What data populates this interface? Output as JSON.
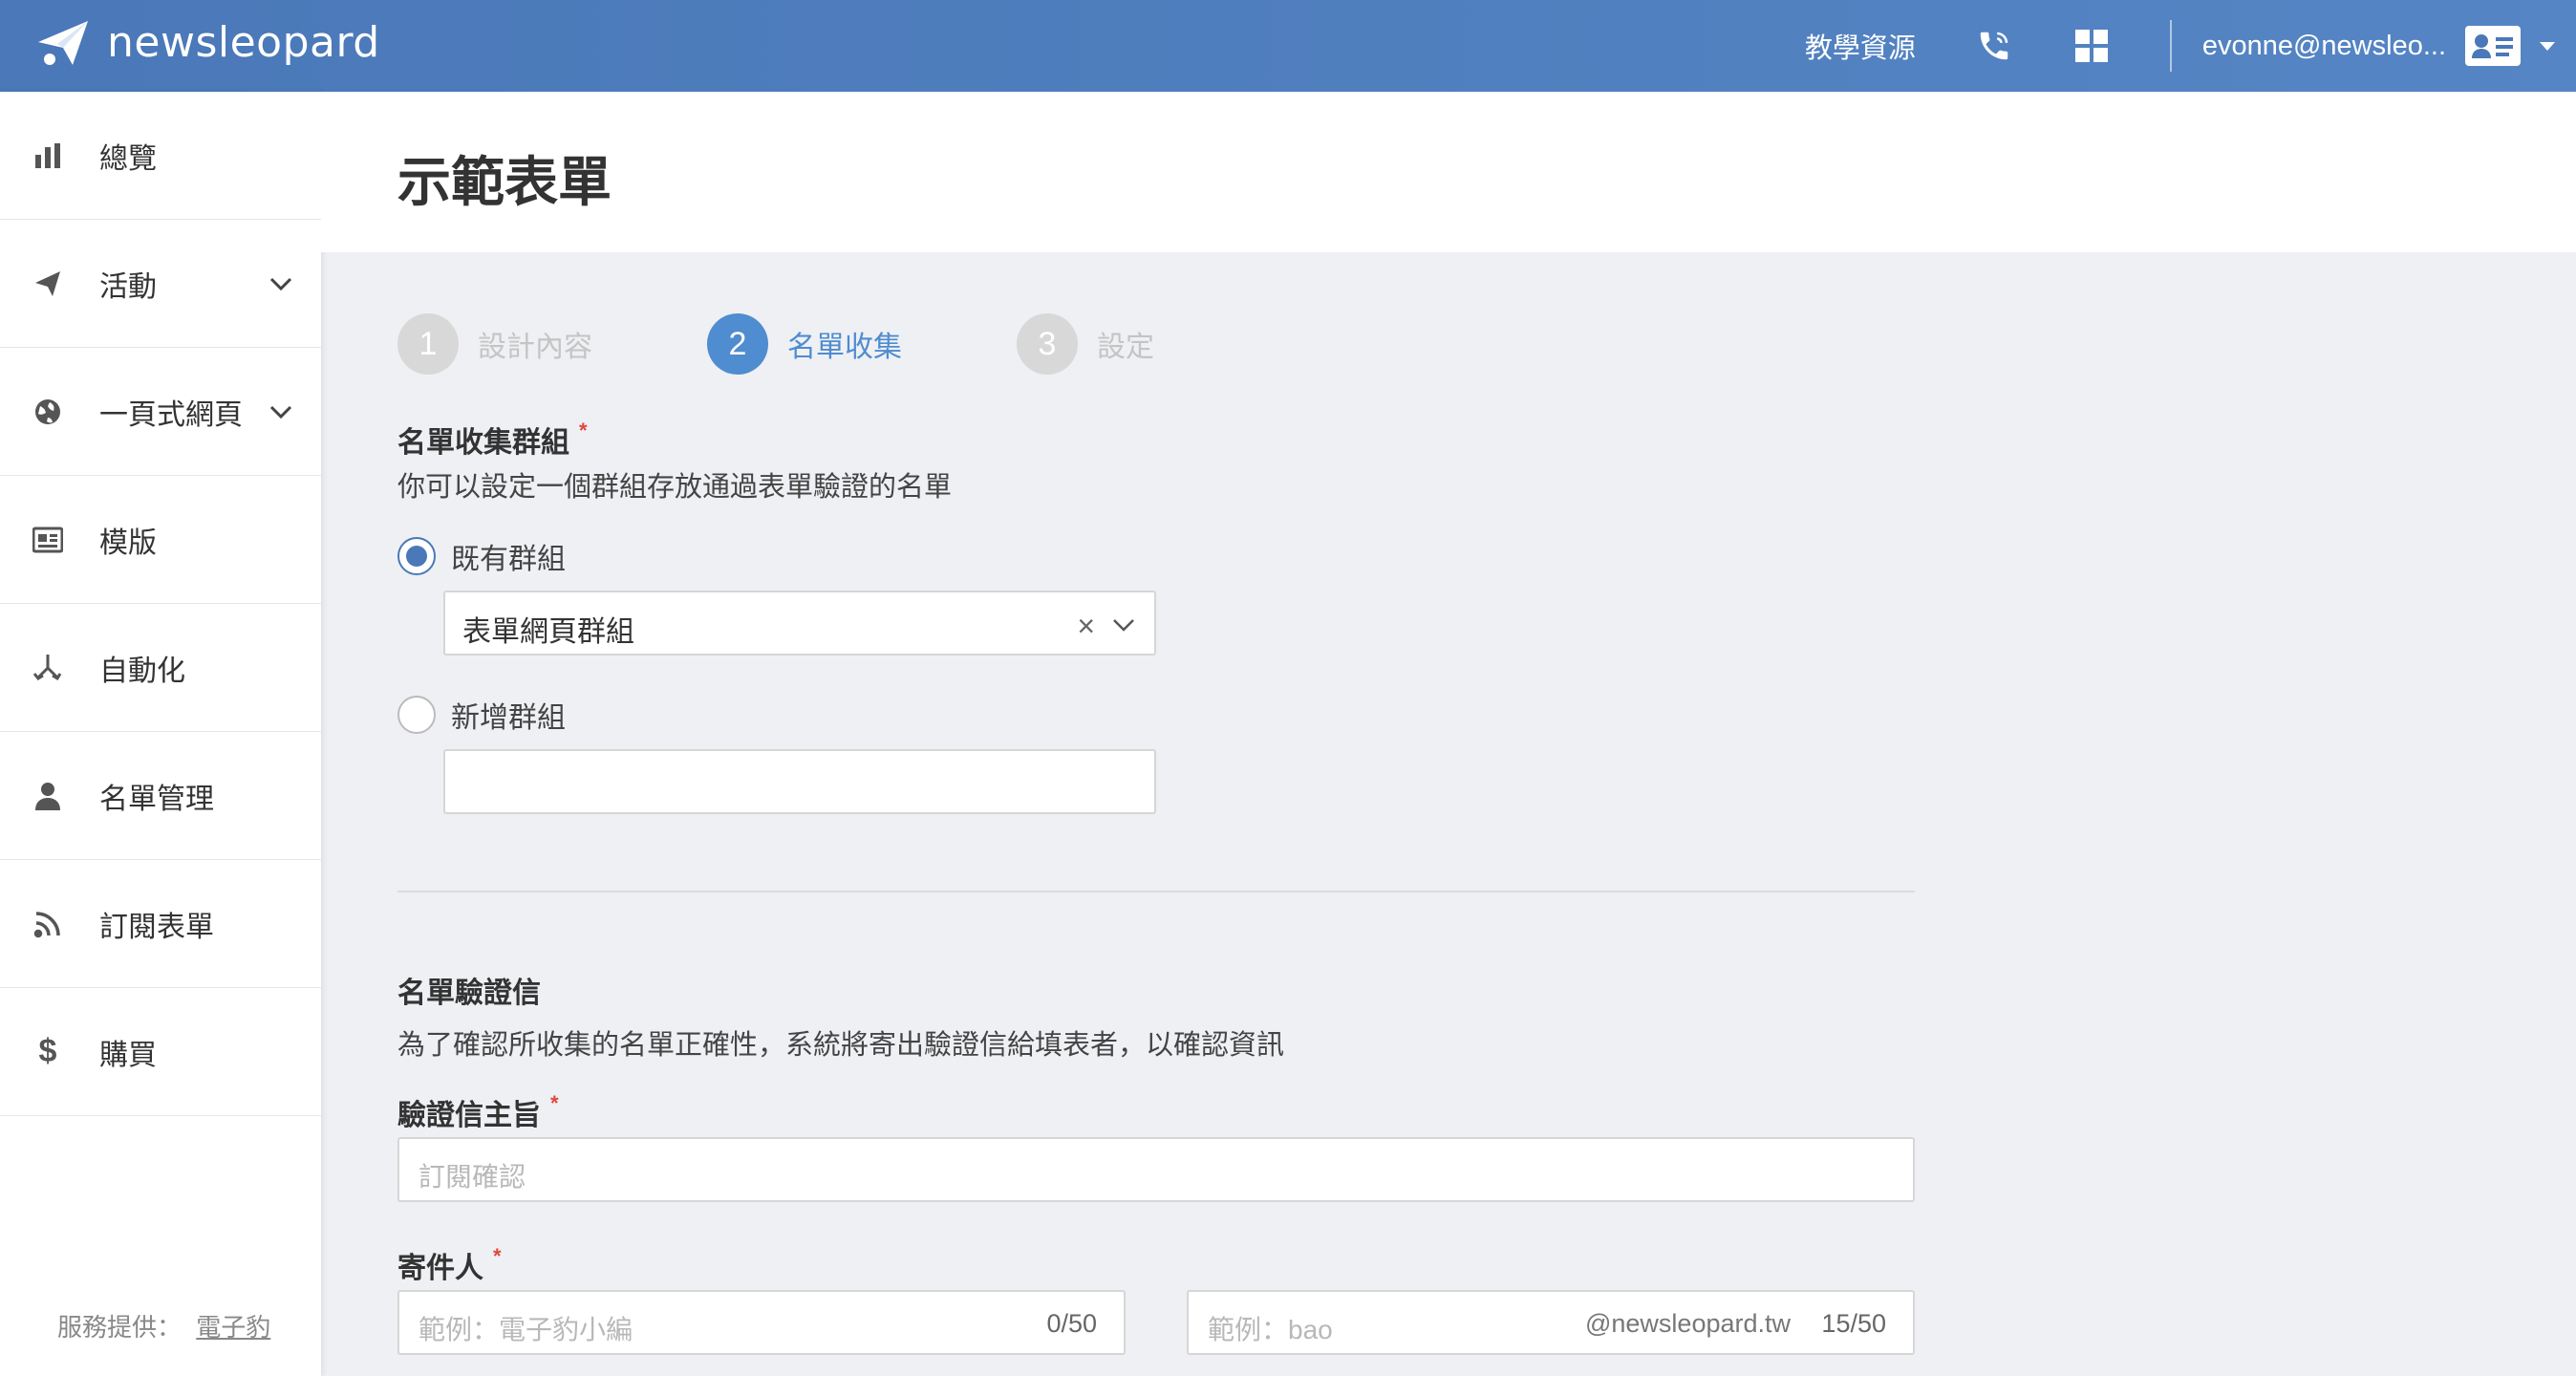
{
  "app": {
    "brand": "newsleopard"
  },
  "topbar": {
    "tutorial_label": "教學資源",
    "phone_icon": "phone-icon",
    "apps_icon": "grid-icon",
    "user_email": "evonne@newsleo...",
    "profile_icon": "id-card-icon"
  },
  "sidebar": {
    "items": [
      {
        "label": "總覽",
        "icon": "bar-chart-icon",
        "expandable": false
      },
      {
        "label": "活動",
        "icon": "paper-plane-icon",
        "expandable": true
      },
      {
        "label": "一頁式網頁",
        "icon": "globe-icon",
        "expandable": true
      },
      {
        "label": "模版",
        "icon": "newspaper-icon",
        "expandable": false
      },
      {
        "label": "自動化",
        "icon": "flow-icon",
        "expandable": false
      },
      {
        "label": "名單管理",
        "icon": "user-icon",
        "expandable": false
      },
      {
        "label": "訂閱表單",
        "icon": "rss-icon",
        "expandable": false
      },
      {
        "label": "購買",
        "icon": "dollar-icon",
        "expandable": false
      }
    ],
    "footer_prefix": "服務提供：",
    "footer_link": "電子豹"
  },
  "page": {
    "title": "示範表單"
  },
  "steps": [
    {
      "number": "1",
      "label": "設計內容",
      "active": false
    },
    {
      "number": "2",
      "label": "名單收集",
      "active": true
    },
    {
      "number": "3",
      "label": "設定",
      "active": false
    }
  ],
  "group_section": {
    "title": "名單收集群組",
    "required_mark": "*",
    "description": "你可以設定一個群組存放通過表單驗證的名單",
    "existing_label": "既有群組",
    "existing_checked": true,
    "selected_group": "表單網頁群組",
    "clear_symbol": "×",
    "new_label": "新增群組",
    "new_group_value": ""
  },
  "verify_section": {
    "title": "名單驗證信",
    "description": "為了確認所收集的名單正確性，系統將寄出驗證信給填表者，以確認資訊",
    "subject_label": "驗證信主旨",
    "subject_placeholder": "訂閱確認",
    "sender_label": "寄件人",
    "sender_name_placeholder": "範例：電子豹小編",
    "sender_name_counter": "0/50",
    "sender_email_placeholder": "範例：bao",
    "sender_email_domain": "@newsleopard.tw",
    "sender_email_counter": "15/50"
  },
  "colors": {
    "topbar": "#4a78b8",
    "accent": "#4f8cd0",
    "required": "#e0463d",
    "background": "#eef0f4"
  }
}
